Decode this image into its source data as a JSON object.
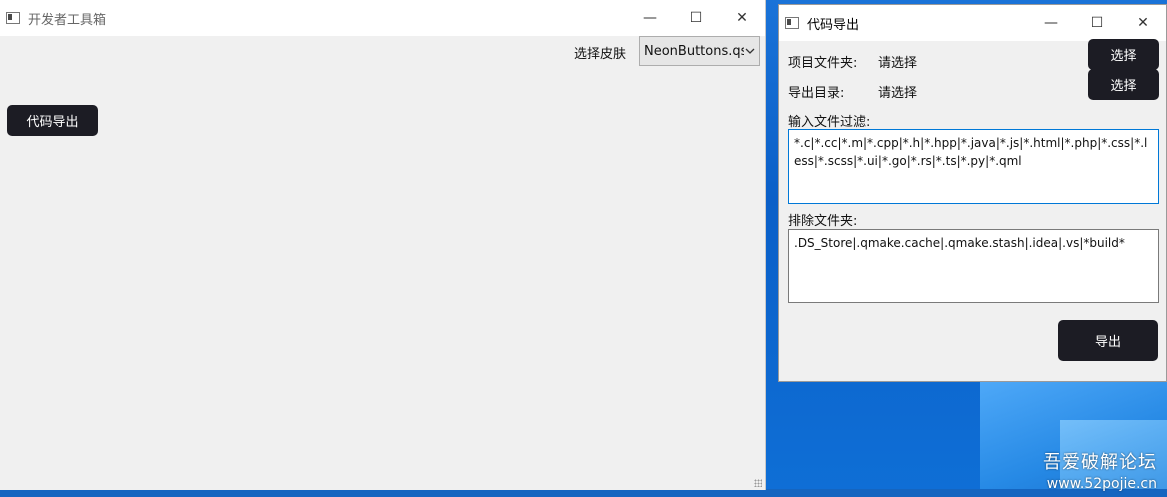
{
  "main_window": {
    "title": "开发者工具箱",
    "skin_label": "选择皮肤",
    "skin_value": "NeonButtons.qss",
    "export_button": "代码导出"
  },
  "export_window": {
    "title": "代码导出",
    "project_folder_label": "项目文件夹:",
    "project_folder_value": "请选择",
    "output_dir_label": "导出目录:",
    "output_dir_value": "请选择",
    "choose_label": "选择",
    "filter_label": "输入文件过滤:",
    "filter_value": "*.c|*.cc|*.m|*.cpp|*.h|*.hpp|*.java|*.js|*.html|*.php|*.css|*.less|*.scss|*.ui|*.go|*.rs|*.ts|*.py|*.qml",
    "exclude_label": "排除文件夹:",
    "exclude_value": ".DS_Store|.qmake.cache|.qmake.stash|.idea|.vs|*build*",
    "export_label": "导出"
  },
  "window_controls": {
    "minimize": "—",
    "maximize": "☐",
    "close": "✕"
  },
  "watermark": {
    "name": "吾爱破解论坛",
    "url": "www.52pojie.cn"
  },
  "colors": {
    "dark_button": "#1c1c24",
    "focus_border": "#0078d7",
    "desktop": "#0a5fc8"
  }
}
